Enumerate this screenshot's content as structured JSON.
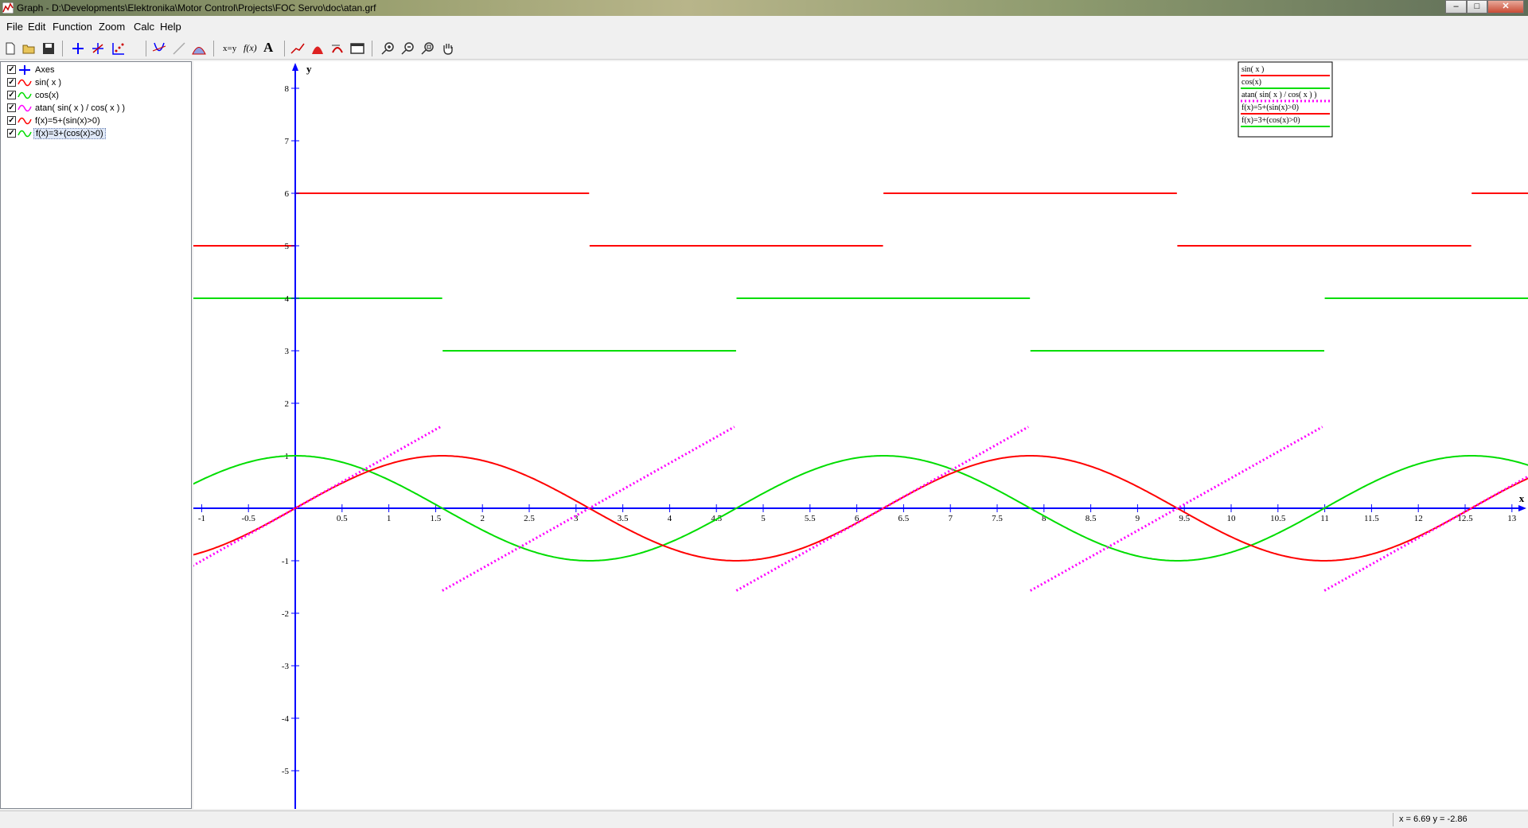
{
  "window": {
    "title": "Graph - D:\\Developments\\Elektronika\\Motor Control\\Projects\\FOC Servo\\doc\\atan.grf"
  },
  "menu": [
    "File",
    "Edit",
    "Function",
    "Zoom",
    "Calc",
    "Help"
  ],
  "toolbar": {
    "buttons": [
      "new-file-icon",
      "open-file-icon",
      "save-icon",
      "insert-axes-icon",
      "insert-point-series-icon",
      "insert-relation-icon",
      "insert-tangent-icon",
      "insert-normal-icon",
      "insert-shading-icon",
      "evaluate-xy-icon",
      "insert-function-icon",
      "insert-label-icon",
      "trace-icon",
      "area-icon",
      "table-icon",
      "window-icon",
      "zoom-in-icon",
      "zoom-out-icon",
      "zoom-square-icon",
      "pan-hand-icon"
    ],
    "text_xy": "x=y",
    "text_fx": "f(x)",
    "text_A": "A"
  },
  "functions": [
    {
      "label": "Axes",
      "checked": true,
      "color": "#0000ff",
      "icon": "axes-icon"
    },
    {
      "label": "sin( x )",
      "checked": true,
      "color": "#ff0000",
      "icon": "function-curve-icon"
    },
    {
      "label": "cos(x)",
      "checked": true,
      "color": "#00dd00",
      "icon": "function-curve-icon"
    },
    {
      "label": "atan( sin( x ) / cos( x ) )",
      "checked": true,
      "color": "#ff00ff",
      "icon": "function-curve-icon"
    },
    {
      "label": "f(x)=5+(sin(x)>0)",
      "checked": true,
      "color": "#ff0000",
      "icon": "function-curve-icon"
    },
    {
      "label": "f(x)=3+(cos(x)>0)",
      "checked": true,
      "color": "#00dd00",
      "icon": "function-curve-icon",
      "selected": true
    }
  ],
  "legend": [
    {
      "label": "sin( x )",
      "color": "#ff0000",
      "dash": false
    },
    {
      "label": "cos(x)",
      "color": "#00dd00",
      "dash": false
    },
    {
      "label": "atan( sin( x ) / cos( x ) )",
      "color": "#ff00ff",
      "dash": true
    },
    {
      "label": "f(x)=5+(sin(x)>0)",
      "color": "#ff0000",
      "dash": false
    },
    {
      "label": "f(x)=3+(cos(x)>0)",
      "color": "#00dd00",
      "dash": false
    }
  ],
  "chart_data": {
    "type": "line",
    "xlabel": "x",
    "ylabel": "y",
    "xlim": [
      -1.1,
      13.4
    ],
    "ylim": [
      -5.8,
      8.4
    ],
    "x_ticks": [
      -1,
      -0.5,
      0.5,
      1,
      1.5,
      2,
      2.5,
      3,
      3.5,
      4,
      4.5,
      5,
      5.5,
      6,
      6.5,
      7,
      7.5,
      8,
      8.5,
      9,
      9.5,
      10,
      10.5,
      11,
      11.5,
      12,
      12.5,
      13
    ],
    "x_tick_labels": [
      "-1",
      "-0.5",
      "0.5",
      "1",
      "1.5",
      "2",
      "2.5",
      "3",
      "3.5",
      "4",
      "4.5",
      "5",
      "5.5",
      "6",
      "6.5",
      "7",
      "7.5",
      "8",
      "8.5",
      "9",
      "9.5",
      "10",
      "10.5",
      "11",
      "11.5",
      "12",
      "12.5",
      "13"
    ],
    "y_ticks": [
      8,
      7,
      6,
      5,
      4,
      3,
      2,
      1,
      -1,
      -2,
      -3,
      -4,
      -5
    ],
    "y_tick_labels": [
      "8",
      "7",
      "6",
      "5",
      "4",
      "3",
      "2",
      "1",
      "-1",
      "-2",
      "-3",
      "-4",
      "-5"
    ],
    "grid": false,
    "legend_position": "top-right",
    "series": [
      {
        "name": "sin( x )",
        "expr": "sin(x)",
        "color": "#ff0000",
        "style": "solid"
      },
      {
        "name": "cos(x)",
        "expr": "cos(x)",
        "color": "#00dd00",
        "style": "solid"
      },
      {
        "name": "atan( sin( x ) / cos( x ) )",
        "expr": "atan(tan(x))",
        "color": "#ff00ff",
        "style": "dotted"
      },
      {
        "name": "f(x)=5+(sin(x)>0)",
        "expr": "5+(sin(x)>0)",
        "color": "#ff0000",
        "style": "solid"
      },
      {
        "name": "f(x)=3+(cos(x)>0)",
        "expr": "3+(cos(x)>0)",
        "color": "#00dd00",
        "style": "solid"
      }
    ]
  },
  "status": {
    "coords": "x = 6.69   y = -2.86"
  }
}
